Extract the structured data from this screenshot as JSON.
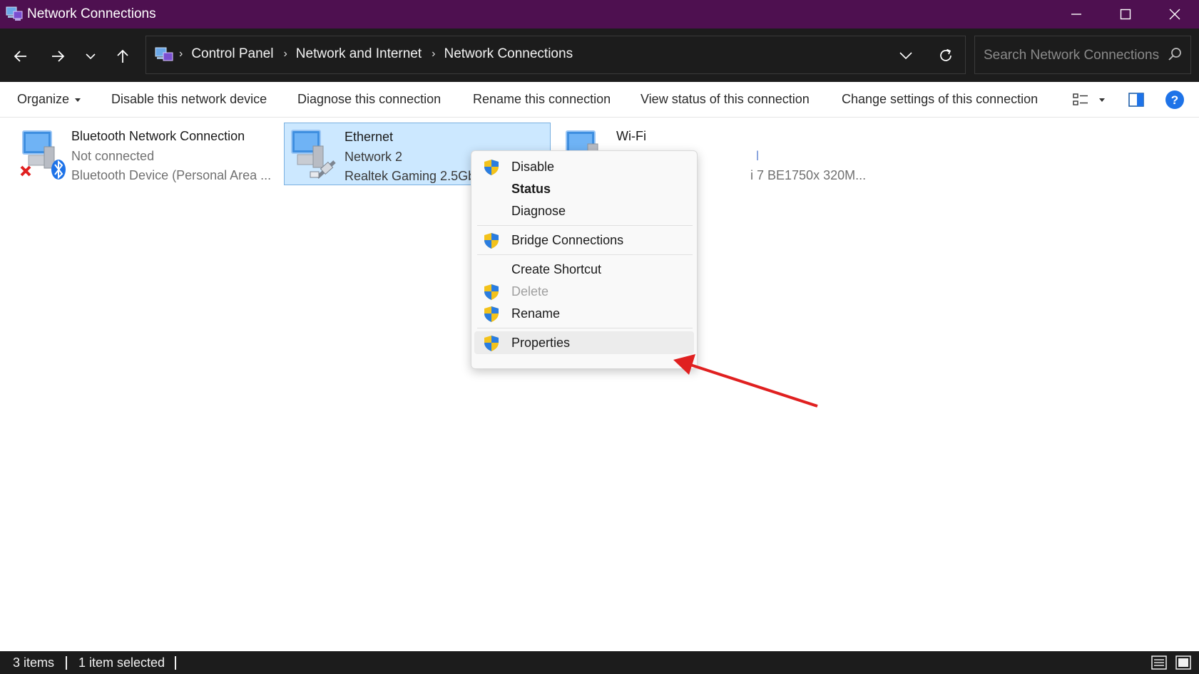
{
  "window": {
    "title": "Network Connections"
  },
  "address": {
    "crumbs": [
      "Control Panel",
      "Network and Internet",
      "Network Connections"
    ]
  },
  "search": {
    "placeholder": "Search Network Connections"
  },
  "commands": {
    "organize": "Organize",
    "disable": "Disable this network device",
    "diagnose": "Diagnose this connection",
    "rename": "Rename this connection",
    "view_status": "View status of this connection",
    "change_settings": "Change settings of this connection"
  },
  "connections": [
    {
      "name": "Bluetooth Network Connection",
      "status": "Not connected",
      "device": "Bluetooth Device (Personal Area ..."
    },
    {
      "name": "Ethernet",
      "status": "Network 2",
      "device": "Realtek Gaming 2.5Gb"
    },
    {
      "name": "Wi-Fi",
      "status": "l",
      "device": "i 7 BE1750x 320M..."
    }
  ],
  "context_menu": {
    "disable": "Disable",
    "status": "Status",
    "diagnose": "Diagnose",
    "bridge": "Bridge Connections",
    "create_shortcut": "Create Shortcut",
    "delete": "Delete",
    "rename": "Rename",
    "properties": "Properties"
  },
  "status_bar": {
    "items": "3 items",
    "selected": "1 item selected"
  },
  "colors": {
    "titlebar": "#4e1050",
    "dark": "#1c1c1c",
    "selection": "#cce8ff",
    "arrow": "#e02020",
    "help": "#1e73e8"
  }
}
